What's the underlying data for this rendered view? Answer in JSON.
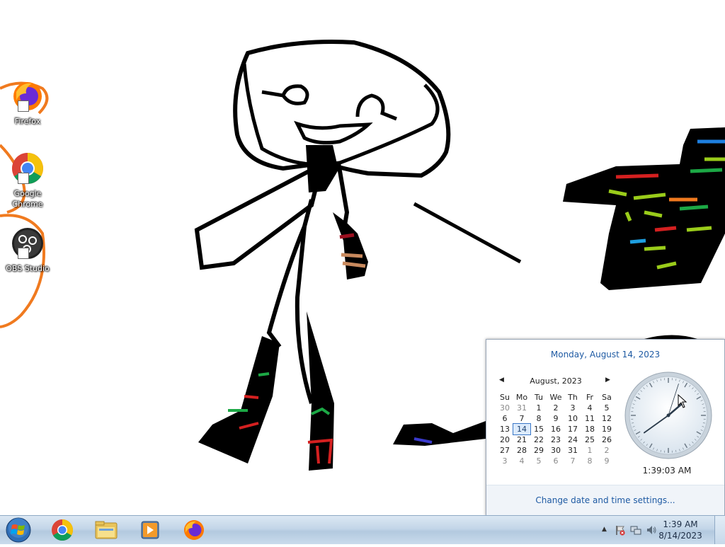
{
  "desktop": {
    "icons": [
      {
        "label": "Firefox",
        "icon": "firefox-icon"
      },
      {
        "label": "Google Chrome",
        "icon": "chrome-icon"
      },
      {
        "label": "OBS Studio",
        "icon": "obs-studio-icon"
      }
    ]
  },
  "flyout": {
    "long_date": "Monday, August 14, 2023",
    "month_label": "August, 2023",
    "weekdays": [
      "Su",
      "Mo",
      "Tu",
      "We",
      "Th",
      "Fr",
      "Sa"
    ],
    "weeks": [
      [
        "30",
        "31",
        "1",
        "2",
        "3",
        "4",
        "5"
      ],
      [
        "6",
        "7",
        "8",
        "9",
        "10",
        "11",
        "12"
      ],
      [
        "13",
        "14",
        "15",
        "16",
        "17",
        "18",
        "19"
      ],
      [
        "20",
        "21",
        "22",
        "23",
        "24",
        "25",
        "26"
      ],
      [
        "27",
        "28",
        "29",
        "30",
        "31",
        "1",
        "2"
      ],
      [
        "3",
        "4",
        "5",
        "6",
        "7",
        "8",
        "9"
      ]
    ],
    "today": "14",
    "clock_time": "1:39:03 AM",
    "settings_link": "Change date and time settings..."
  },
  "taskbar": {
    "pinned": [
      "chrome-icon",
      "file-explorer-icon",
      "media-player-icon",
      "firefox-icon"
    ],
    "tray_time": "1:39 AM",
    "tray_date": "8/14/2023"
  },
  "colors": {
    "accent_link": "#1e5aa3",
    "taskbar": "#c3d6e8"
  }
}
